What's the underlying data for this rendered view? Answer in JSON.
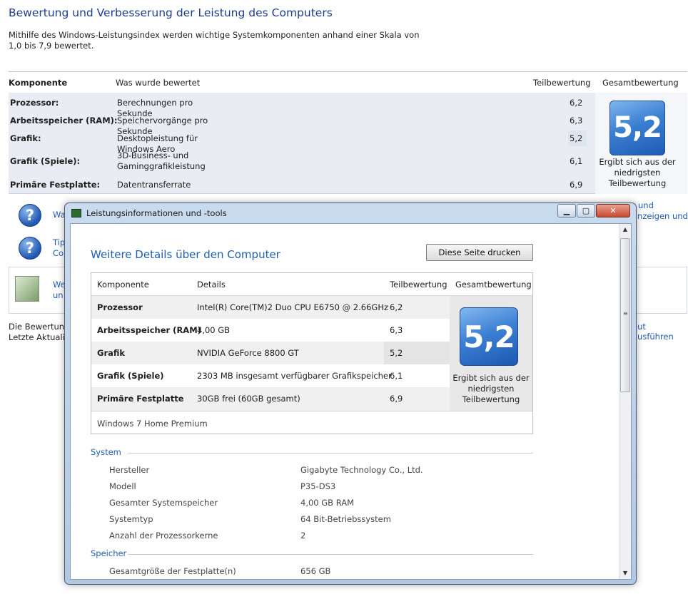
{
  "background": {
    "title": "Bewertung und Verbesserung der Leistung des Computers",
    "intro": "Mithilfe des Windows-Leistungsindex werden wichtige Systemkomponenten anhand einer Skala von 1,0 bis 7,9 bewertet.",
    "headers": {
      "component": "Komponente",
      "rated": "Was wurde bewertet",
      "subscore": "Teilbewertung",
      "basescore": "Gesamtbewertung"
    },
    "rows": [
      {
        "component": "Prozessor:",
        "rated": "Berechnungen pro Sekunde",
        "score": "6,2"
      },
      {
        "component": "Arbeitsspeicher (RAM):",
        "rated": "Speichervorgänge pro Sekunde",
        "score": "6,3"
      },
      {
        "component": "Grafik:",
        "rated": "Desktopleistung für Windows Aero",
        "score": "5,2"
      },
      {
        "component": "Grafik (Spiele):",
        "rated": "3D-Business- und Gaminggrafikleistung",
        "score": "6,1"
      },
      {
        "component": "Primäre Festplatte:",
        "rated": "Datentransferrate",
        "score": "6,9"
      }
    ],
    "base_score": "5,2",
    "base_caption": "Ergibt sich aus der niedrigsten Teilbewertung",
    "link1_left": "Wa",
    "link2_left_a": "Tip",
    "link2_left_b": "Co",
    "link1_right": "und",
    "link2_right": "anzeigen und",
    "box_link_a": "We",
    "box_link_b": "un",
    "footer_a": "Die Bewertung",
    "footer_b": "Letzte Aktualisi",
    "footer_right": "eut ausführen"
  },
  "dialog": {
    "title": "Leistungsinformationen und -tools",
    "heading": "Weitere Details über den Computer",
    "print_label": "Diese Seite drucken",
    "headers": {
      "component": "Komponente",
      "details": "Details",
      "subscore": "Teilbewertung",
      "basescore": "Gesamtbewertung"
    },
    "rows": [
      {
        "component": "Prozessor",
        "details": "Intel(R) Core(TM)2 Duo CPU E6750 @ 2.66GHz",
        "score": "6,2"
      },
      {
        "component": "Arbeitsspeicher (RAM)",
        "details": "4,00 GB",
        "score": "6,3"
      },
      {
        "component": "Grafik",
        "details": "NVIDIA GeForce 8800 GT",
        "score": "5,2"
      },
      {
        "component": "Grafik (Spiele)",
        "details": "2303 MB insgesamt verfügbarer Grafikspeicher",
        "score": "6,1"
      },
      {
        "component": "Primäre Festplatte",
        "details": "30GB frei (60GB gesamt)",
        "score": "6,9"
      }
    ],
    "base_score": "5,2",
    "base_caption": "Ergibt sich aus der niedrigsten Teilbewertung",
    "os": "Windows 7 Home Premium",
    "system_label": "System",
    "system": [
      {
        "key": "Hersteller",
        "value": "Gigabyte Technology Co., Ltd."
      },
      {
        "key": "Modell",
        "value": "P35-DS3"
      },
      {
        "key": "Gesamter Systemspeicher",
        "value": "4,00 GB RAM"
      },
      {
        "key": "Systemtyp",
        "value": "64 Bit-Betriebssystem"
      },
      {
        "key": "Anzahl der Prozessorkerne",
        "value": "2"
      }
    ],
    "storage_label": "Speicher",
    "storage": [
      {
        "key": "Gesamtgröße der Festplatte(n)",
        "value": "656 GB"
      }
    ]
  }
}
